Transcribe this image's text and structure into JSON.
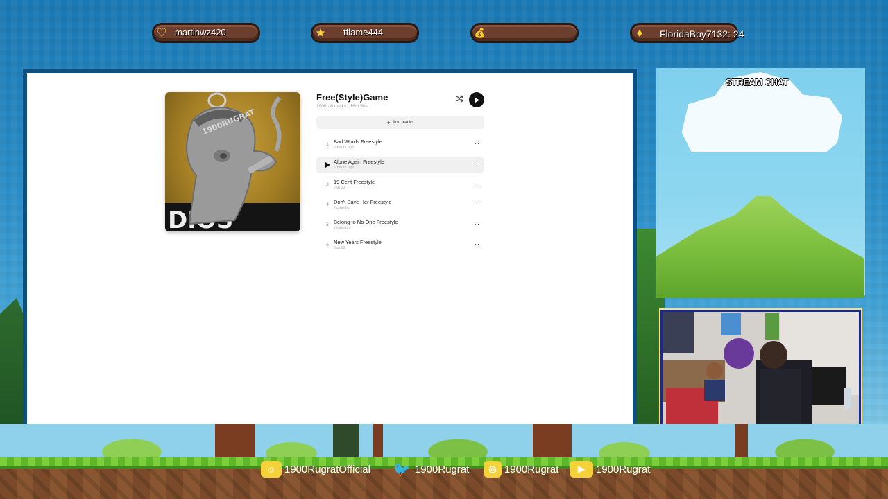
{
  "alerts": [
    {
      "icon": "heart-icon",
      "glyph": "♡",
      "text": "martinwz420"
    },
    {
      "icon": "star-icon",
      "glyph": "★",
      "text": "tflame444"
    },
    {
      "icon": "money-bag-icon",
      "glyph": "💰",
      "text": ""
    },
    {
      "icon": "diamond-icon",
      "glyph": "♦",
      "text": "FloridaBoy7132: 24"
    }
  ],
  "playlist": {
    "title": "Free(Style)Game",
    "meta": "1900 · 6 tracks · 16m 50s",
    "add_tracks_label": "Add tracks",
    "tracks": [
      {
        "num": "1",
        "name": "Bad Words Freestyle",
        "date": "6 hours ago"
      },
      {
        "num": "2",
        "name": "Alone Again Freestyle",
        "date": "6 hours ago"
      },
      {
        "num": "3",
        "name": "19 Cent Freestyle",
        "date": "Jan 13"
      },
      {
        "num": "4",
        "name": "Don't Save Her Freestyle",
        "date": "Yesterday"
      },
      {
        "num": "5",
        "name": "Belong to No One Freestyle",
        "date": "Yesterday"
      },
      {
        "num": "6",
        "name": "New Years Freestyle",
        "date": "Jan 13"
      }
    ],
    "more_glyph": "···"
  },
  "chat": {
    "title": "STREAM CHAT"
  },
  "socials": [
    {
      "icon": "discord-icon",
      "text": "1900RugratOfficial"
    },
    {
      "icon": "twitter-icon",
      "text": "1900Rugrat"
    },
    {
      "icon": "instagram-icon",
      "text": "1900Rugrat"
    },
    {
      "icon": "youtube-icon",
      "text": "1900Rugrat"
    }
  ],
  "colors": {
    "accent": "#111111",
    "badge": "#6b3e2e",
    "social": "#f5d23a"
  }
}
